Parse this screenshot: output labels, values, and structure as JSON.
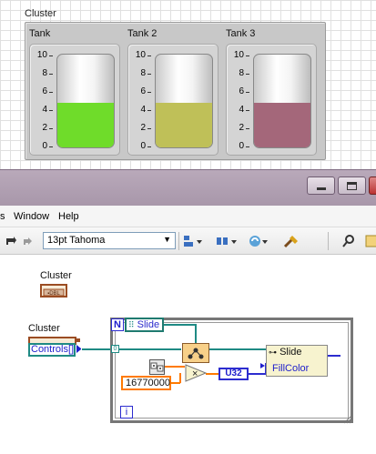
{
  "front_panel": {
    "cluster_label": "Cluster",
    "scale_labels": [
      "10",
      "8",
      "6",
      "4",
      "2",
      "0"
    ],
    "tanks": [
      {
        "label": "Tank",
        "level": 4.8,
        "max": 10,
        "fill_color": "#6fdc2a"
      },
      {
        "label": "Tank 2",
        "level": 4.8,
        "max": 10,
        "fill_color": "#bfc058"
      },
      {
        "label": "Tank 3",
        "level": 4.8,
        "max": 10,
        "fill_color": "#a4677a"
      }
    ]
  },
  "menubar": {
    "items": [
      "s",
      "Window",
      "Help"
    ]
  },
  "toolbar": {
    "font_select": "13pt Tahoma"
  },
  "block_diagram": {
    "cluster_const_label": "Cluster",
    "cluster_term_label": "Cluster",
    "controls_label": "Controls[]",
    "slide_ref": "Slide",
    "loop_count_terminal": "N",
    "loop_iteration_terminal": "i",
    "numeric_constant": "16770000",
    "conversion_node": "U32",
    "property_node": {
      "ref": "Slide",
      "property": "FillColor"
    },
    "index_terminal": "0"
  },
  "colors": {
    "wire_orange": "#ff7a00",
    "wire_teal": "#1f8a84",
    "wire_blue": "#2c2ccf",
    "titlebar": "#b3a3b4"
  }
}
